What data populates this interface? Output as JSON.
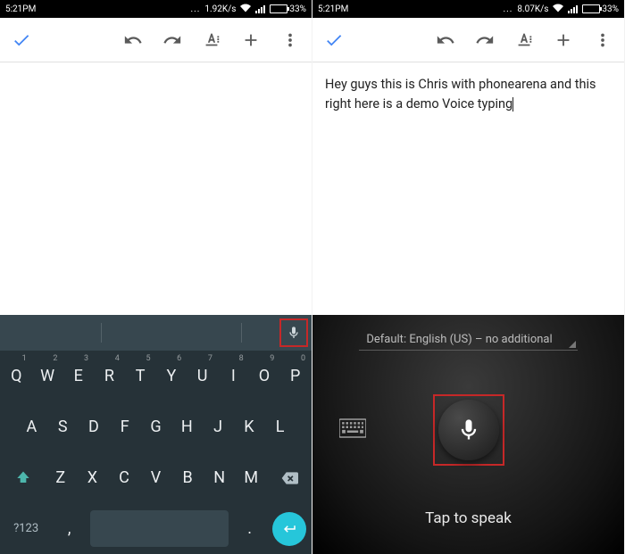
{
  "status": {
    "time": "5:21PM",
    "net_left": "1.92K/s",
    "net_right": "8.07K/s",
    "battery_pct": "33%",
    "battery_fill_pct": 33
  },
  "document": {
    "left_text": "",
    "right_text": "Hey guys this is Chris with phonearena and this right here is a demo Voice typing"
  },
  "keyboard": {
    "rows": {
      "r1": [
        {
          "k": "Q",
          "s": "1"
        },
        {
          "k": "W",
          "s": "2"
        },
        {
          "k": "E",
          "s": "3"
        },
        {
          "k": "R",
          "s": "4"
        },
        {
          "k": "T",
          "s": "5"
        },
        {
          "k": "Y",
          "s": "6"
        },
        {
          "k": "U",
          "s": "7"
        },
        {
          "k": "I",
          "s": "8"
        },
        {
          "k": "O",
          "s": "9"
        },
        {
          "k": "P",
          "s": "0"
        }
      ],
      "r2": [
        "A",
        "S",
        "D",
        "F",
        "G",
        "H",
        "J",
        "K",
        "L"
      ],
      "r3": [
        "Z",
        "X",
        "C",
        "V",
        "B",
        "N",
        "M"
      ]
    },
    "sym_label": "?123",
    "comma": ",",
    "period": "."
  },
  "voice": {
    "language_label": "Default: English (US) – no additional",
    "tap_label": "Tap to speak"
  }
}
